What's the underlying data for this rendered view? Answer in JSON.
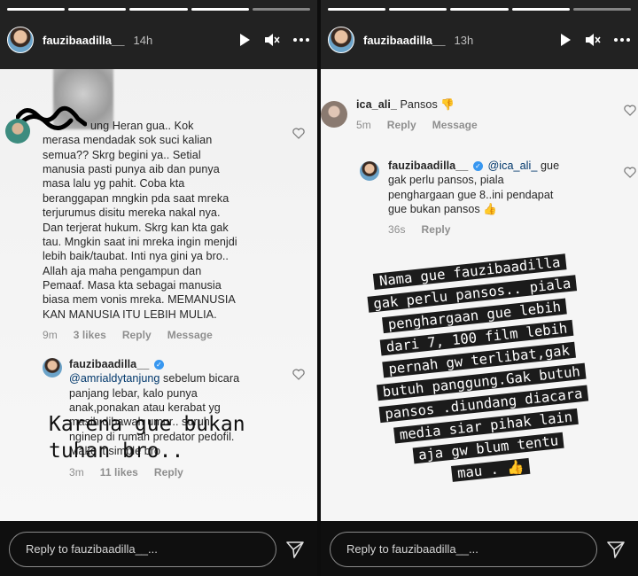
{
  "stories": {
    "left": {
      "username": "fauzibaadilla__",
      "time": "14h",
      "comments": [
        {
          "text": "...ung Heran gua.. Kok merasa mendadak sok suci kalian semua?? Skrg begini ya.. Setial manusia pasti punya aib dan punya masa lalu yg pahit. Coba kta beranggapan mngkin pda saat mreka terjurumus disitu mereka nakal nya. Dan terjerat hukum. Skrg kan kta gak tau. Mngkin saat ini mreka ingin menjdi lebih baik/taubat. Inti nya gini ya bro.. Allah aja maha pengampun dan Pemaaf. Masa kta sebagai manusia biasa mem vonis mreka. MEMANUSIA KAN MANUSIA ITU LEBIH MULIA.",
          "lines": [
            "ung Heran gua.. Kok",
            "merasa mendadak sok suci kalian",
            "semua?? Skrg begini ya.. Setial",
            "manusia pasti punya aib dan punya",
            "masa lalu yg pahit. Coba kta",
            "beranggapan mngkin pda saat mreka",
            "terjurumus disitu mereka nakal nya.",
            "Dan terjerat hukum. Skrg kan kta gak",
            "tau. Mngkin saat ini mreka ingin menjdi",
            "lebih baik/taubat. Inti nya gini ya bro..",
            "Allah aja maha pengampun dan",
            "Pemaaf. Masa kta sebagai manusia",
            "biasa mem vonis mreka. MEMANUSIA",
            "KAN MANUSIA ITU LEBIH MULIA."
          ],
          "time": "9m",
          "likes": "3 likes",
          "reply": "Reply",
          "message": "Message"
        },
        {
          "username": "fauzibaadilla__",
          "mention": "@amrialdytanjung",
          "lines_after_mention": [
            " sebelum bicara",
            "panjang lebar, kalo punya",
            "anak,ponakan atau kerabat yg",
            "masih dibawah umur.. suruh",
            "nginep di rumah predator pedofil.",
            "Make it simple bro"
          ],
          "time": "3m",
          "likes": "11 likes",
          "reply": "Reply"
        }
      ],
      "caption": [
        "Karena gue bukan",
        "tuhan bro.."
      ],
      "reply_placeholder": "Reply to fauzibaadilla__..."
    },
    "right": {
      "username": "fauzibaadilla__",
      "time": "13h",
      "comments": [
        {
          "username": "ica_ali_",
          "text": "Pansos 👎",
          "time": "5m",
          "reply": "Reply",
          "message": "Message"
        },
        {
          "username": "fauzibaadilla__",
          "mention": "@ica_ali_",
          "lines": [
            "gue",
            "gak perlu pansos, piala",
            "penghargaan gue 8..ini pendapat",
            "gue bukan pansos 👍"
          ],
          "time": "36s",
          "reply": "Reply"
        }
      ],
      "label_lines": [
        "Nama gue fauzibaadilla",
        "gak perlu pansos.. piala",
        "penghargaan gue lebih",
        "dari 7, 100 film lebih",
        "pernah gw terlibat,gak",
        "butuh panggung.Gak butuh",
        "pansos .diundang diacara",
        "media siar pihak lain",
        "aja gw blum tentu",
        "mau . 👍"
      ],
      "reply_placeholder": "Reply to fauzibaadilla__..."
    }
  },
  "colors": {
    "header_bg": "#222222",
    "content_bg": "#f5f5f5",
    "text": "#262626",
    "meta": "#8e8e8e",
    "verified": "#3897f0",
    "mention": "#00376b",
    "label_bg": "#1b1b1b"
  },
  "icons": [
    "play-icon",
    "mute-icon",
    "more-icon",
    "heart-icon",
    "send-icon",
    "verified-icon"
  ]
}
